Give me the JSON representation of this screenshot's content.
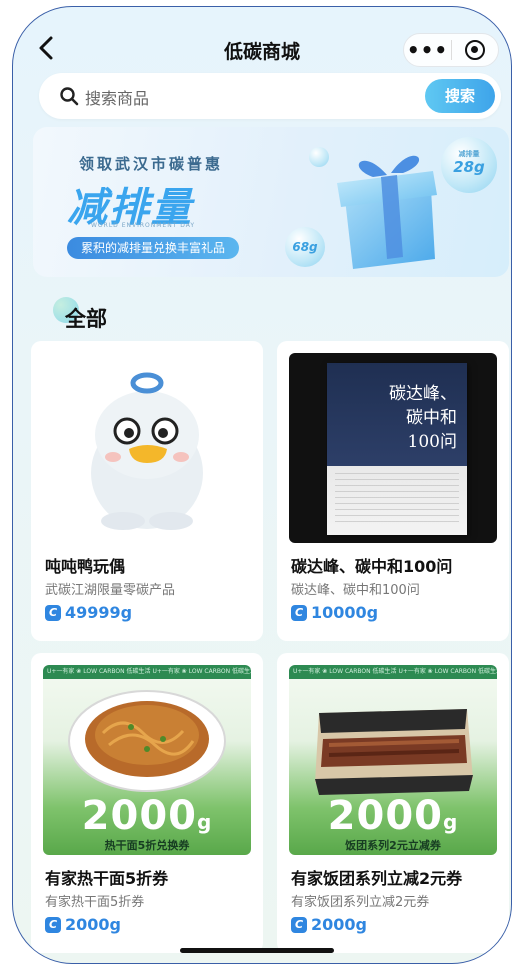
{
  "header": {
    "title": "低碳商城",
    "back_icon": "chevron-left-icon",
    "more_icon": "more-dots-icon",
    "close_icon": "target-circle-icon",
    "more_label": "•••"
  },
  "search": {
    "placeholder": "搜索商品",
    "button_label": "搜索"
  },
  "banner": {
    "line1": "领取武汉市碳普惠",
    "line2": "减排量",
    "small_text": "WORLD ENVIRONMENT DAY",
    "pill": "累积的减排量兑换丰富礼品",
    "bubble_top_label": "减排量",
    "bubble_top_value": "28g",
    "bubble_bottom_value": "68g"
  },
  "section": {
    "title": "全部"
  },
  "products": [
    {
      "title": "吨吨鸭玩偶",
      "subtitle": "武碳江湖限量零碳产品",
      "price": "49999g",
      "image": "duck-plush-image"
    },
    {
      "title": "碳达峰、碳中和100问",
      "subtitle": "碳达峰、碳中和100问",
      "price": "10000g",
      "image": "book-cover-image",
      "book_title_line1": "碳达峰、",
      "book_title_line2": "碳中和",
      "book_title_line3": "100问"
    },
    {
      "title": "有家热干面5折券",
      "subtitle": "有家热干面5折券",
      "price": "2000g",
      "image": "noodle-voucher-image",
      "voucher_value": "2000",
      "voucher_unit": "g",
      "voucher_label": "热干面5折兑换券"
    },
    {
      "title": "有家饭团系列立减2元券",
      "subtitle": "有家饭团系列立减2元券",
      "price": "2000g",
      "image": "riceball-voucher-image",
      "voucher_value": "2000",
      "voucher_unit": "g",
      "voucher_label": "饭团系列2元立减券"
    }
  ],
  "voucher_strip_text": "U+一有家  ❀  LOW CARBON 低碳生活  U+一有家  ❀  LOW CARBON 低碳生活",
  "coin_glyph": "C",
  "colors": {
    "accent": "#2f86e0",
    "search_button": "#3ea4ea",
    "voucher_green": "#5aae4e"
  }
}
